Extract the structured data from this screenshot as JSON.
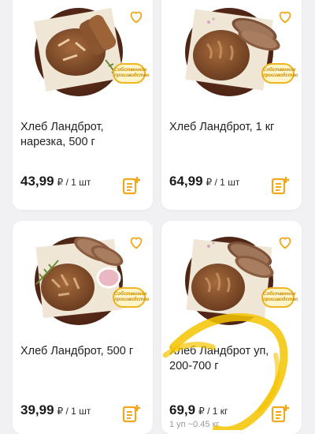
{
  "products": [
    {
      "title": "Хлеб Ландброт, нарезка, 500 г",
      "price": "43,99",
      "unit": "₽ / 1 шт",
      "icons": {
        "favorite": "heart-outline-icon",
        "cart": "add-to-cart-icon"
      },
      "badge": "Собственное производство"
    },
    {
      "title": "Хлеб Ландброт, 1 кг",
      "price": "64,99",
      "unit": "₽ / 1 шт",
      "icons": {
        "favorite": "heart-outline-icon",
        "cart": "add-to-cart-icon"
      },
      "badge": "Собственное производство"
    },
    {
      "title": "Хлеб Ландброт, 500 г",
      "price": "39,99",
      "unit": "₽ / 1 шт",
      "icons": {
        "favorite": "heart-outline-icon",
        "cart": "add-to-cart-icon"
      },
      "badge": "Собственное производство"
    },
    {
      "title": "Хлеб Ландброт уп, 200-700 г",
      "price": "69,9",
      "unit": "₽ / 1 кг",
      "weight_note": "1 уп ~0.45 кг",
      "icons": {
        "favorite": "heart-outline-icon",
        "cart": "add-to-cart-icon"
      },
      "badge": "Собственное производство"
    }
  ],
  "colors": {
    "accent": "#f0a81c",
    "background": "#f1f1f3",
    "card": "#ffffff"
  }
}
